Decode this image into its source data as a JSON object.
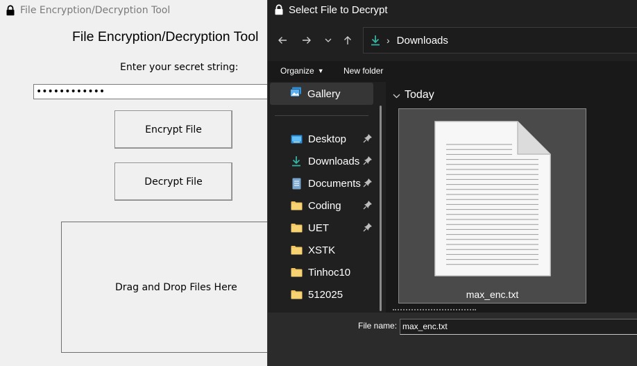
{
  "app": {
    "window_title": "File Encryption/Decryption Tool",
    "heading": "File Encryption/Decryption Tool",
    "secret_label": "Enter your secret string:",
    "secret_value": "••••••••••••",
    "encrypt_label": "Encrypt File",
    "decrypt_label": "Decrypt File",
    "drop_label": "Drag and Drop Files Here"
  },
  "dialog": {
    "title": "Select File to Decrypt",
    "address": {
      "location": "Downloads",
      "location_icon": "download-icon"
    },
    "toolbar": {
      "organize_label": "Organize",
      "new_folder_label": "New folder"
    },
    "nav": {
      "gallery": "Gallery",
      "items": [
        {
          "label": "Desktop",
          "icon": "desktop-icon",
          "pinned": true
        },
        {
          "label": "Downloads",
          "icon": "download-icon",
          "pinned": true
        },
        {
          "label": "Documents",
          "icon": "documents-icon",
          "pinned": true
        },
        {
          "label": "Coding",
          "icon": "folder-icon",
          "pinned": true
        },
        {
          "label": "UET",
          "icon": "folder-icon",
          "pinned": true
        },
        {
          "label": "XSTK",
          "icon": "folder-icon",
          "pinned": false
        },
        {
          "label": "Tinhoc10",
          "icon": "folder-icon",
          "pinned": false
        },
        {
          "label": "512025",
          "icon": "folder-icon",
          "pinned": false
        }
      ]
    },
    "content": {
      "group_label": "Today",
      "file_name": "max_enc.txt"
    },
    "bottom": {
      "file_name_label": "File name:",
      "file_name_value": "max_enc.txt"
    },
    "colors": {
      "background": "#202020",
      "tile_selected": "#4a4a4a",
      "folder": "#f2c55c",
      "accent": "#4cc2ff"
    }
  }
}
